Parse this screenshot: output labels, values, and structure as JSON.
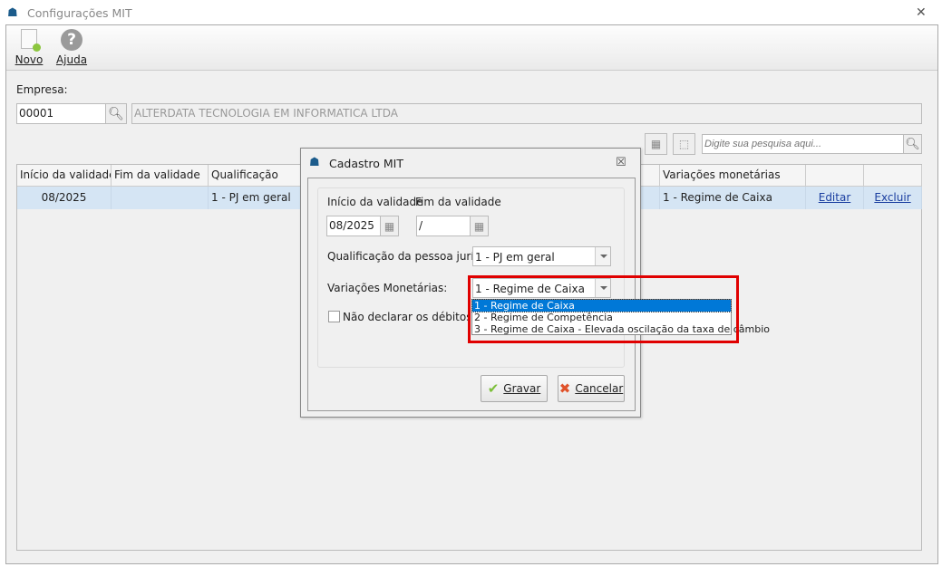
{
  "window": {
    "title": "Configurações MIT",
    "close": "✕"
  },
  "toolbar": {
    "novo": "Novo",
    "ajuda": "Ajuda"
  },
  "empresa": {
    "label": "Empresa:",
    "code": "00001",
    "name": "ALTERDATA TECNOLOGIA EM INFORMATICA LTDA"
  },
  "search": {
    "placeholder": "Digite sua pesquisa aqui..."
  },
  "grid": {
    "headers": [
      "Início da validade",
      "Fim da validade",
      "Qualificação",
      "Variações monetárias",
      "",
      ""
    ],
    "rows": [
      {
        "inicio": "08/2025",
        "fim": "",
        "qualificacao": "1 - PJ em geral",
        "variacoes": "1 - Regime de Caixa",
        "editar": "Editar",
        "excluir": "Excluir"
      }
    ]
  },
  "dialog": {
    "title": "Cadastro MIT",
    "close": "☒",
    "inicio_label": "Início da validade",
    "inicio_value": "08/2025",
    "fim_label": "Fim da validade",
    "fim_value": " /",
    "qualif_label": "Qualificação da pessoa jurídica:",
    "qualif_value": "1 - PJ em geral",
    "var_label": "Variações Monetárias:",
    "var_value": "1 - Regime de Caixa",
    "var_options": [
      "1 - Regime de Caixa",
      "2 - Regime de Competência",
      "3 - Regime de Caixa - Elevada oscilação da taxa de câmbio"
    ],
    "checkbox_label": "Não declarar os débitos abaixo",
    "gravar": "Gravar",
    "cancelar": "Cancelar"
  },
  "colors": {
    "highlight": "#0078d7",
    "annotation": "#e00000",
    "row": "#d5e5f4"
  }
}
